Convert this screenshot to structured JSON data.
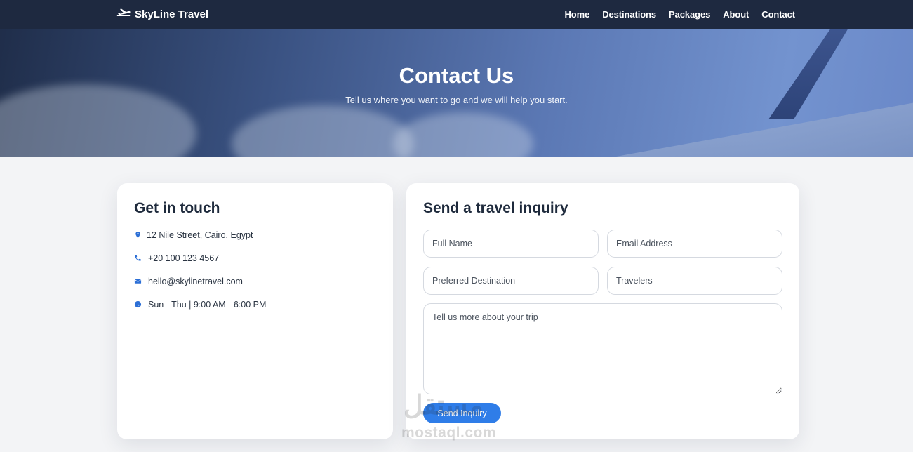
{
  "brand": {
    "name": "SkyLine Travel",
    "icon": "plane-icon"
  },
  "nav": {
    "items": [
      {
        "label": "Home"
      },
      {
        "label": "Destinations"
      },
      {
        "label": "Packages"
      },
      {
        "label": "About"
      },
      {
        "label": "Contact"
      }
    ]
  },
  "hero": {
    "title": "Contact Us",
    "subtitle": "Tell us where you want to go and we will help you start."
  },
  "contact": {
    "title": "Get in touch",
    "items": [
      {
        "icon": "location-pin-icon",
        "text": "12 Nile Street, Cairo, Egypt"
      },
      {
        "icon": "phone-icon",
        "text": "+20 100 123 4567"
      },
      {
        "icon": "envelope-icon",
        "text": "hello@skylinetravel.com"
      },
      {
        "icon": "clock-icon",
        "text": "Sun - Thu | 9:00 AM - 6:00 PM"
      }
    ]
  },
  "form": {
    "title": "Send a travel inquiry",
    "fields": {
      "full_name": {
        "placeholder": "Full Name",
        "value": ""
      },
      "email": {
        "placeholder": "Email Address",
        "value": ""
      },
      "destination": {
        "placeholder": "Preferred Destination",
        "value": ""
      },
      "travelers": {
        "placeholder": "Travelers",
        "value": ""
      },
      "message": {
        "placeholder": "Tell us more about your trip",
        "value": ""
      }
    },
    "submit_label": "Send Inquiry"
  },
  "watermark": {
    "arabic": "مستقل",
    "latin": "mostaql.com"
  },
  "colors": {
    "navbar": "#1e2940",
    "accent": "#2f7de8",
    "icon": "#2c6fd6",
    "heading": "#1e2a3c"
  }
}
